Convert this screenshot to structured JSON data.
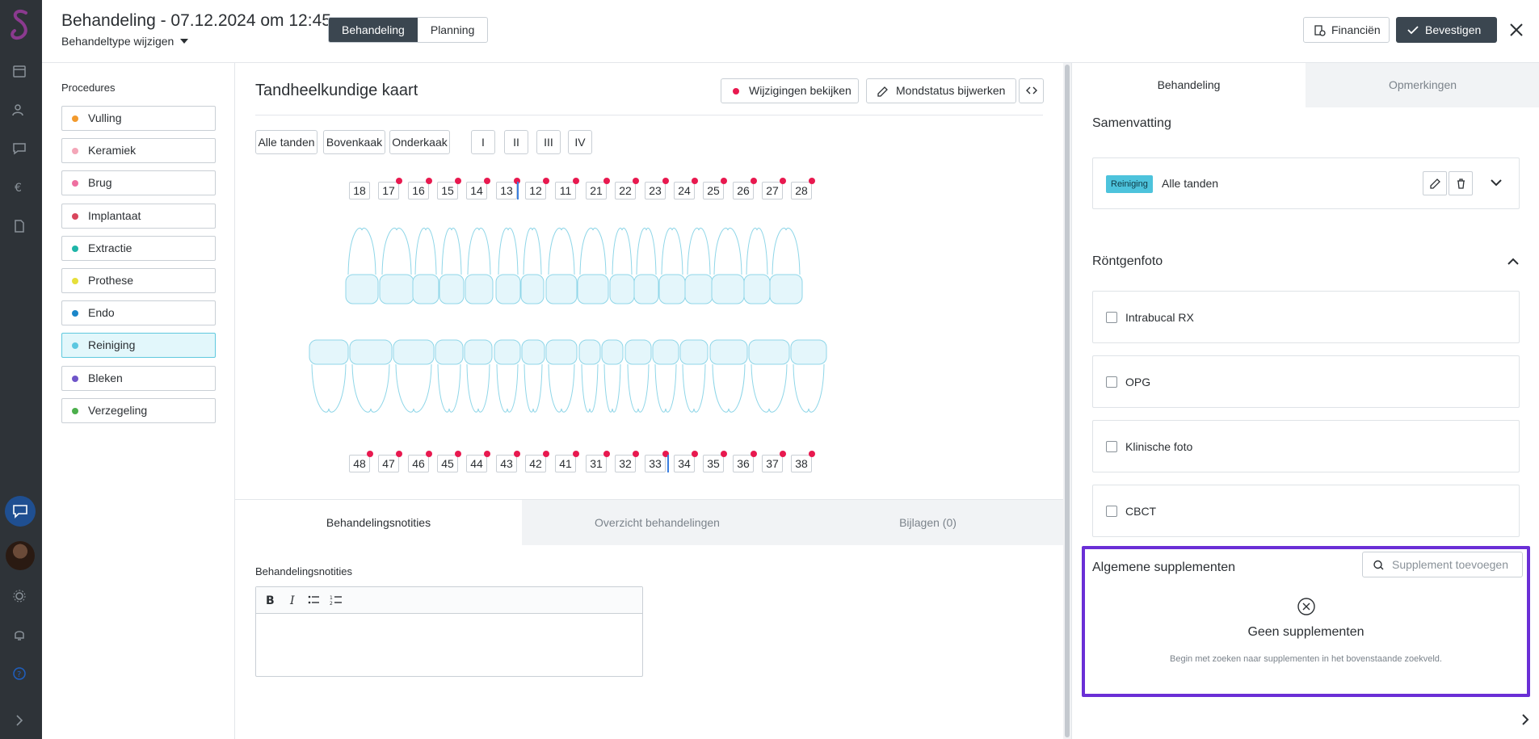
{
  "header": {
    "title": "Behandeling - 07.12.2024 om 12:45",
    "type_change": "Behandeltype wijzigen",
    "segments": [
      "Behandeling",
      "Planning"
    ],
    "finance_label": "Financiën",
    "confirm_label": "Bevestigen"
  },
  "procedures": {
    "heading": "Procedures",
    "items": [
      {
        "label": "Vulling",
        "color": "#f29a2e"
      },
      {
        "label": "Keramiek",
        "color": "#f4a6b8"
      },
      {
        "label": "Brug",
        "color": "#ee6fa0"
      },
      {
        "label": "Implantaat",
        "color": "#d9465d"
      },
      {
        "label": "Extractie",
        "color": "#1fb5a8"
      },
      {
        "label": "Prothese",
        "color": "#e6df3a"
      },
      {
        "label": "Endo",
        "color": "#1a86c9"
      },
      {
        "label": "Reiniging",
        "color": "#5bc7e0"
      },
      {
        "label": "Bleken",
        "color": "#6f55c9"
      },
      {
        "label": "Verzegeling",
        "color": "#4caf4c"
      }
    ],
    "selected": "Reiniging"
  },
  "chart": {
    "title": "Tandheelkundige kaart",
    "changes_label": "Wijzigingen bekijken",
    "status_label": "Mondstatus bijwerken",
    "filters": [
      "Alle tanden",
      "Bovenkaak",
      "Onderkaak"
    ],
    "quadrants": [
      "I",
      "II",
      "III",
      "IV"
    ],
    "upper_right": [
      "18",
      "17",
      "16",
      "15",
      "14",
      "13",
      "12",
      "11"
    ],
    "upper_left": [
      "21",
      "22",
      "23",
      "24",
      "25",
      "26",
      "27",
      "28"
    ],
    "lower_right": [
      "48",
      "47",
      "46",
      "45",
      "44",
      "43",
      "42",
      "41"
    ],
    "lower_left": [
      "31",
      "32",
      "33",
      "34",
      "35",
      "36",
      "37",
      "38"
    ]
  },
  "bottom_tabs": [
    "Behandelingsnotities",
    "Overzicht behandelingen",
    "Bijlagen (0)"
  ],
  "notes": {
    "label": "Behandelingsnotities"
  },
  "right_panel": {
    "tabs": [
      "Behandeling",
      "Opmerkingen"
    ],
    "summary_heading": "Samenvatting",
    "summary_badge": "Reiniging",
    "summary_teeth": "Alle tanden",
    "xray_heading": "Röntgenfoto",
    "xray_options": [
      "Intrabucal RX",
      "OPG",
      "Klinische foto",
      "CBCT"
    ],
    "supplements_heading": "Algemene supplementen",
    "add_supplement": "Supplement toevoegen",
    "empty_title": "Geen supplementen",
    "empty_hint": "Begin met zoeken naar supplementen in het bovenstaande zoekveld."
  },
  "colors": {
    "accent_dark": "#3b4650",
    "marker_red": "#e8194f",
    "tooth_fill": "#e4f6fb",
    "tooth_stroke": "#8fd6e8",
    "highlight_border": "#6a2fd6"
  }
}
